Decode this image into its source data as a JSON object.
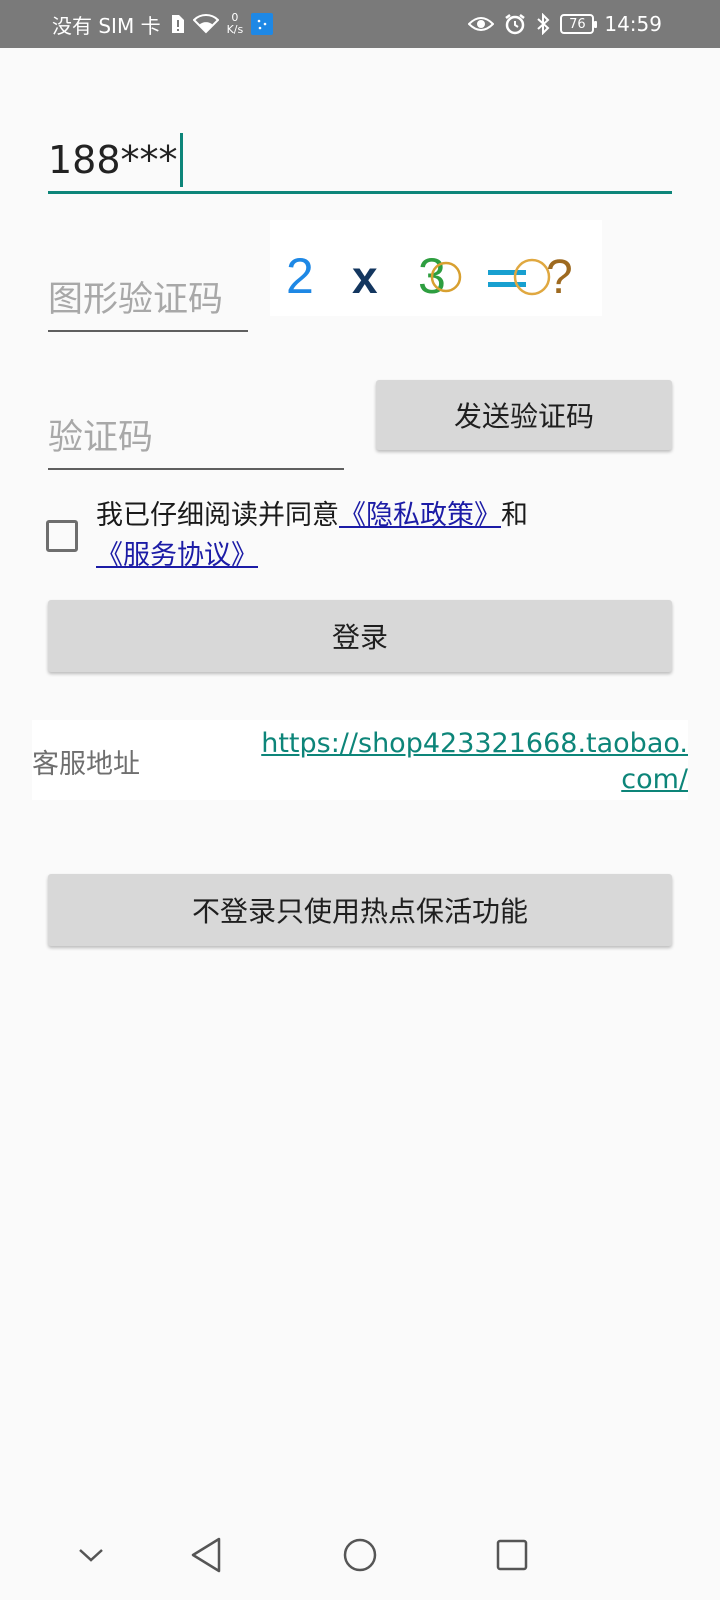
{
  "status_bar": {
    "carrier": "没有 SIM 卡",
    "net_speed_value": "0",
    "net_speed_unit": "K/s",
    "battery": "76",
    "time": "14:59"
  },
  "form": {
    "phone_value": "188***",
    "captcha_placeholder": "图形验证码",
    "captcha_image_text": "2 x 3 =?",
    "sms_code_placeholder": "验证码",
    "send_code_button": "发送验证码",
    "agree_prefix": "我已仔细阅读并同意",
    "privacy_link": "《隐私政策》",
    "agree_and": "和",
    "service_link": "《服务协议》",
    "login_button": "登录"
  },
  "service": {
    "label": "客服地址",
    "url": "https://shop423321668.taobao.com/"
  },
  "hotspot_button": "不登录只使用热点保活功能",
  "colors": {
    "accent": "#0d8579",
    "link": "#1c1ca6",
    "button_bg": "#d8d8d8",
    "status_bar_bg": "#7a7a7a"
  },
  "nav_icons": [
    "chevron-down-icon",
    "back-icon",
    "home-icon",
    "recents-icon"
  ]
}
